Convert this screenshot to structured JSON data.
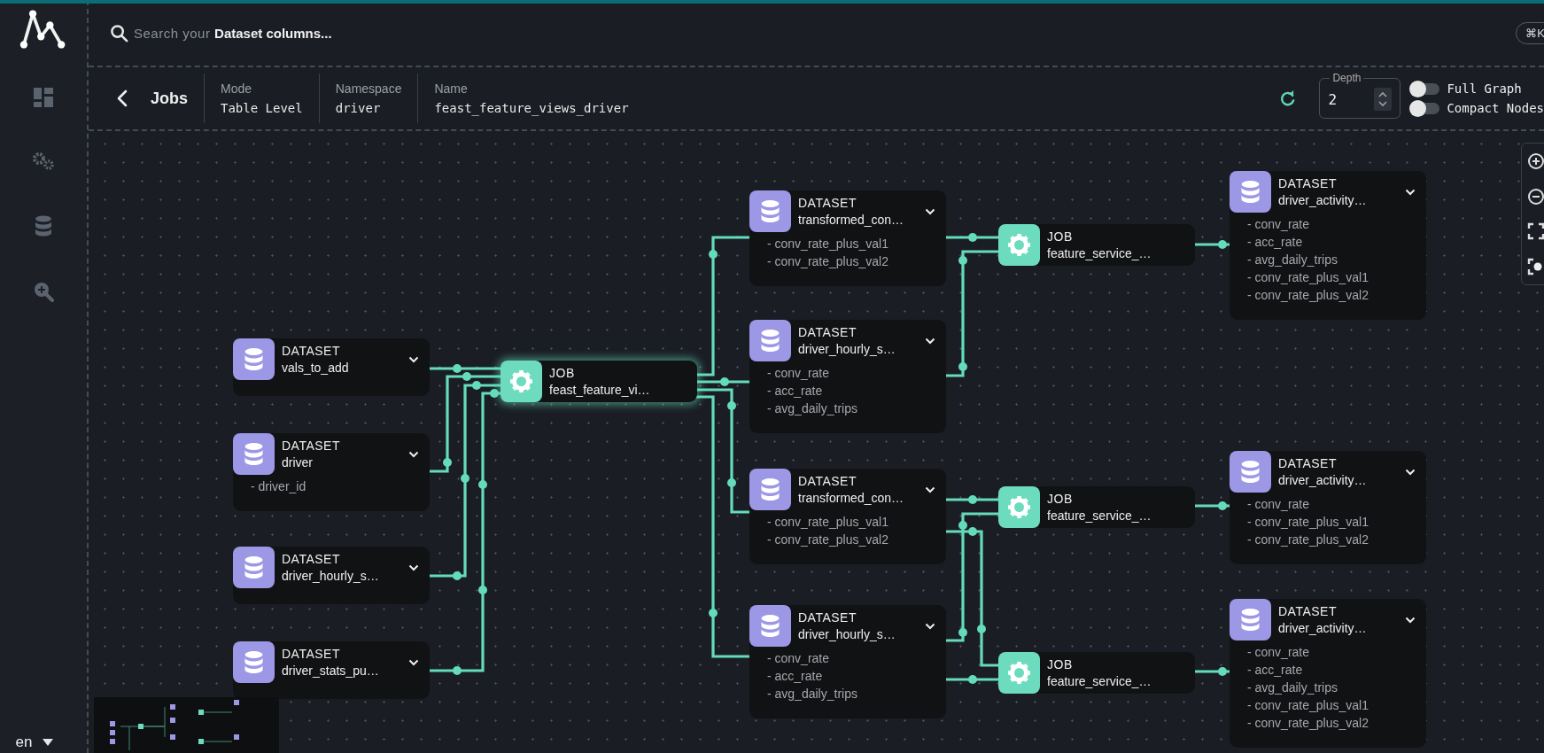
{
  "search": {
    "placeholder": "Search your **Dataset columns...**",
    "shortcut": "⌘K"
  },
  "breadcrumb": {
    "title": "Jobs",
    "fields": [
      {
        "label": "Mode",
        "value": "Table Level"
      },
      {
        "label": "Namespace",
        "value": "driver"
      },
      {
        "label": "Name",
        "value": "feast_feature_views_driver"
      }
    ]
  },
  "depth": {
    "label": "Depth",
    "value": "2"
  },
  "toggles": [
    {
      "label": "Full Graph",
      "on": false
    },
    {
      "label": "Compact Nodes",
      "on": false
    }
  ],
  "graph": {
    "nodes": [
      {
        "kind": "dataset",
        "type": "DATASET",
        "name": "vals_to_add",
        "selected": false
      },
      {
        "kind": "dataset",
        "type": "DATASET",
        "name": "driver",
        "fields": [
          "- driver_id"
        ],
        "selected": false
      },
      {
        "kind": "dataset",
        "type": "DATASET",
        "name": "driver_hourly_s…",
        "selected": false
      },
      {
        "kind": "dataset",
        "type": "DATASET",
        "name": "driver_stats_pu…",
        "selected": false
      },
      {
        "kind": "job",
        "type": "JOB",
        "name": "feast_feature_vi…",
        "selected": true
      },
      {
        "kind": "dataset",
        "type": "DATASET",
        "name": "transformed_con…",
        "fields": [
          "- conv_rate_plus_val1",
          "- conv_rate_plus_val2"
        ],
        "selected": false
      },
      {
        "kind": "dataset",
        "type": "DATASET",
        "name": "driver_hourly_s…",
        "fields": [
          "- conv_rate",
          "- acc_rate",
          "- avg_daily_trips"
        ],
        "selected": false
      },
      {
        "kind": "dataset",
        "type": "DATASET",
        "name": "transformed_con…",
        "fields": [
          "- conv_rate_plus_val1",
          "- conv_rate_plus_val2"
        ],
        "selected": false
      },
      {
        "kind": "dataset",
        "type": "DATASET",
        "name": "driver_hourly_s…",
        "fields": [
          "- conv_rate",
          "- acc_rate",
          "- avg_daily_trips"
        ],
        "selected": false
      },
      {
        "kind": "job",
        "type": "JOB",
        "name": "feature_service_…",
        "selected": false
      },
      {
        "kind": "job",
        "type": "JOB",
        "name": "feature_service_…",
        "selected": false
      },
      {
        "kind": "job",
        "type": "JOB",
        "name": "feature_service_…",
        "selected": false
      },
      {
        "kind": "dataset",
        "type": "DATASET",
        "name": "driver_activity…",
        "fields": [
          "- conv_rate",
          "- acc_rate",
          "- avg_daily_trips",
          "- conv_rate_plus_val1",
          "- conv_rate_plus_val2"
        ],
        "selected": false
      },
      {
        "kind": "dataset",
        "type": "DATASET",
        "name": "driver_activity…",
        "fields": [
          "- conv_rate",
          "- conv_rate_plus_val1",
          "- conv_rate_plus_val2"
        ],
        "selected": false
      },
      {
        "kind": "dataset",
        "type": "DATASET",
        "name": "driver_activity…",
        "fields": [
          "- conv_rate",
          "- acc_rate",
          "- avg_daily_trips",
          "- conv_rate_plus_val1",
          "- conv_rate_plus_val2"
        ],
        "selected": false
      }
    ]
  },
  "language": "en"
}
